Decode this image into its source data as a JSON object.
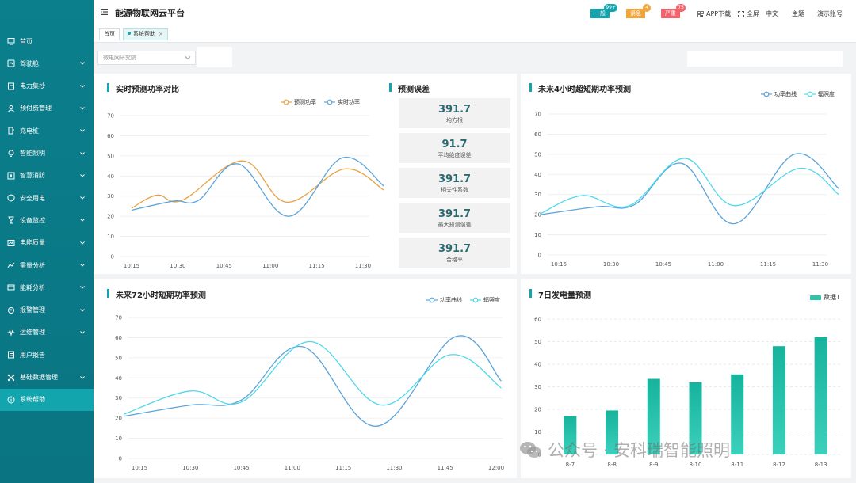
{
  "app": {
    "title": "能源物联网云平台"
  },
  "header": {
    "alerts": [
      {
        "label": "一般",
        "count": "99+",
        "color": "#13a5ae",
        "count_color": "#13a5ae"
      },
      {
        "label": "紧急",
        "count": "4",
        "color": "#f0a43a",
        "count_color": "#f0a43a"
      },
      {
        "label": "严重",
        "count": "75",
        "color": "#f2626a",
        "count_color": "#f2626a"
      }
    ],
    "app_download": "APP下载",
    "fullscreen": "全屏",
    "language": "中文",
    "theme": "主题",
    "account": "演示账号"
  },
  "sidebar": {
    "items": [
      {
        "label": "首页",
        "icon": "monitor-icon",
        "chevron": false
      },
      {
        "label": "驾驶舱",
        "icon": "dashboard-icon",
        "chevron": true
      },
      {
        "label": "电力集抄",
        "icon": "meter-icon",
        "chevron": true
      },
      {
        "label": "预付费管理",
        "icon": "user-icon",
        "chevron": true
      },
      {
        "label": "充电桩",
        "icon": "charger-icon",
        "chevron": true
      },
      {
        "label": "智能照明",
        "icon": "bulb-icon",
        "chevron": true
      },
      {
        "label": "智慧消防",
        "icon": "fire-icon",
        "chevron": true
      },
      {
        "label": "安全用电",
        "icon": "shield-icon",
        "chevron": true
      },
      {
        "label": "设备监控",
        "icon": "camera-icon",
        "chevron": true
      },
      {
        "label": "电能质量",
        "icon": "quality-icon",
        "chevron": true
      },
      {
        "label": "需量分析",
        "icon": "analysis-icon",
        "chevron": true
      },
      {
        "label": "能耗分析",
        "icon": "energy-icon",
        "chevron": true
      },
      {
        "label": "报警管理",
        "icon": "alarm-icon",
        "chevron": true
      },
      {
        "label": "运维管理",
        "icon": "wave-icon",
        "chevron": true
      },
      {
        "label": "用户报告",
        "icon": "report-icon",
        "chevron": false
      },
      {
        "label": "基础数据管理",
        "icon": "database-icon",
        "chevron": true
      },
      {
        "label": "系统帮助",
        "icon": "info-icon",
        "chevron": false
      }
    ],
    "active_index": 16
  },
  "tabs": [
    {
      "label": "首页"
    },
    {
      "label": "系统帮助",
      "close": "×"
    }
  ],
  "filter": {
    "placeholder": "微电网研究院"
  },
  "panels": {
    "realtime": {
      "title": "实时预测功率对比"
    },
    "errors": {
      "title": "预测误差",
      "cards": [
        {
          "value": "391.7",
          "label": "均方根"
        },
        {
          "value": "91.7",
          "label": "平均绝度误差"
        },
        {
          "value": "391.7",
          "label": "相关性系数"
        },
        {
          "value": "391.7",
          "label": "最大预测误差"
        },
        {
          "value": "391.7",
          "label": "合格率"
        }
      ]
    },
    "ultra_short": {
      "title": "未来4小时超短期功率预测"
    },
    "short": {
      "title": "未来72小时短期功率预测"
    },
    "weekly": {
      "title": "7日发电量预测"
    }
  },
  "watermark": "公众号 · 安科瑞智能照明",
  "chart_data": [
    {
      "type": "line",
      "title": "实时预测功率对比",
      "x": [
        "10:15",
        "10:30",
        "10:45",
        "11:00",
        "11:15",
        "11:30"
      ],
      "ylim": [
        0,
        70
      ],
      "yticks": [
        0,
        10,
        20,
        30,
        40,
        50,
        60,
        70
      ],
      "grid": true,
      "legend_placement": "top-right",
      "series": [
        {
          "name": "预测功率",
          "color": "#e8a245",
          "points": [
            [
              0,
              24
            ],
            [
              0.55,
              30.5
            ],
            [
              1.1,
              28
            ],
            [
              2.4,
              47.5
            ],
            [
              3.35,
              27
            ],
            [
              4.6,
              43.5
            ],
            [
              5.45,
              33
            ]
          ]
        },
        {
          "name": "实时功率",
          "color": "#5ba3d9",
          "points": [
            [
              0,
              23
            ],
            [
              0.9,
              27.5
            ],
            [
              1.45,
              28
            ],
            [
              2.3,
              46
            ],
            [
              3.4,
              20
            ],
            [
              4.55,
              49
            ],
            [
              5.45,
              35
            ]
          ]
        }
      ]
    },
    {
      "type": "line",
      "title": "未来4小时超短期功率预测",
      "x": [
        "10:15",
        "10:30",
        "10:45",
        "11:00",
        "11:15",
        "11:30"
      ],
      "ylim": [
        0,
        70
      ],
      "yticks": [
        0,
        10,
        20,
        30,
        40,
        50,
        60,
        70
      ],
      "grid": true,
      "legend_placement": "top-right",
      "series": [
        {
          "name": "功率曲线",
          "color": "#5ba3d9",
          "points": [
            [
              -0.35,
              20
            ],
            [
              0.75,
              24
            ],
            [
              1.45,
              25
            ],
            [
              2.35,
              45.5
            ],
            [
              3.35,
              15.5
            ],
            [
              4.5,
              50
            ],
            [
              5.35,
              33
            ]
          ]
        },
        {
          "name": "辐照度",
          "color": "#4fd8ec",
          "points": [
            [
              -0.35,
              20.5
            ],
            [
              0.45,
              29.5
            ],
            [
              1.35,
              24.5
            ],
            [
              2.4,
              48
            ],
            [
              3.35,
              24.5
            ],
            [
              4.6,
              43
            ],
            [
              5.35,
              30
            ]
          ]
        }
      ]
    },
    {
      "type": "line",
      "title": "未来72小时短期功率预测",
      "x": [
        "10:15",
        "10:30",
        "10:45",
        "11:00",
        "11:15",
        "11:30",
        "11:45",
        "12:00"
      ],
      "ylim": [
        0,
        70
      ],
      "yticks": [
        0,
        10,
        20,
        30,
        40,
        50,
        60,
        70
      ],
      "grid": true,
      "legend_placement": "top-right",
      "series": [
        {
          "name": "功率曲线",
          "color": "#5ba3d9",
          "points": [
            [
              -0.3,
              21
            ],
            [
              1.0,
              26.5
            ],
            [
              2.0,
              29
            ],
            [
              3.2,
              55.5
            ],
            [
              4.65,
              16
            ],
            [
              6.2,
              60.5
            ],
            [
              7.1,
              38.5
            ]
          ]
        },
        {
          "name": "辐照度",
          "color": "#4fd8ec",
          "points": [
            [
              -0.3,
              22
            ],
            [
              1.0,
              33.5
            ],
            [
              2.0,
              28
            ],
            [
              3.35,
              58
            ],
            [
              4.75,
              26.5
            ],
            [
              6.1,
              51.5
            ],
            [
              7.1,
              35
            ]
          ]
        }
      ]
    },
    {
      "type": "bar",
      "title": "7日发电量预测",
      "categories": [
        "8-7",
        "8-8",
        "8-9",
        "8-10",
        "8-11",
        "8-12",
        "8-13"
      ],
      "series": [
        {
          "name": "数据1",
          "values": [
            17,
            19.5,
            33.5,
            32,
            35.5,
            48,
            52
          ],
          "color": "#2ec4a9"
        }
      ],
      "ylim": [
        0,
        60
      ],
      "yticks": [
        0,
        10,
        20,
        30,
        40,
        50,
        60
      ],
      "grid": true,
      "legend_placement": "top-right"
    }
  ]
}
